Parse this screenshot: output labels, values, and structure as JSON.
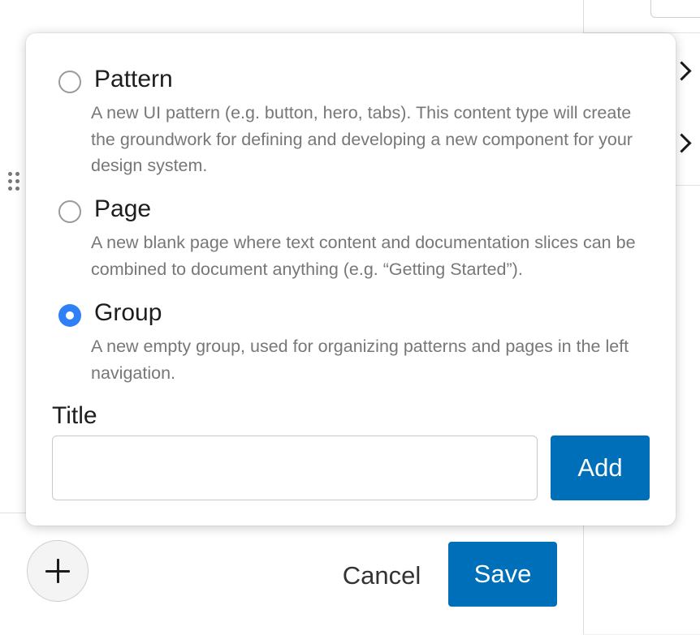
{
  "popover": {
    "options": [
      {
        "label": "Pattern",
        "description": "A new UI pattern (e.g. button, hero, tabs). This content type will create the groundwork for defining and developing a new component for your design system.",
        "selected": false
      },
      {
        "label": "Page",
        "description": "A new blank page where text content and documentation slices can be combined to document anything (e.g. “Getting Started”).",
        "selected": false
      },
      {
        "label": "Group",
        "description": "A new empty group, used for organizing patterns and pages in the left navigation.",
        "selected": true
      }
    ],
    "title_label": "Title",
    "title_value": "",
    "title_placeholder": "",
    "add_label": "Add"
  },
  "footer": {
    "cancel_label": "Cancel",
    "save_label": "Save"
  },
  "icons": {
    "add": "plus-icon",
    "expand": "chevron-right-icon",
    "drag": "drag-handle-icon"
  },
  "colors": {
    "primary": "#006fb9",
    "radio_selected": "#2f80f7",
    "description_text": "#777777",
    "border": "#c9c9c9"
  }
}
